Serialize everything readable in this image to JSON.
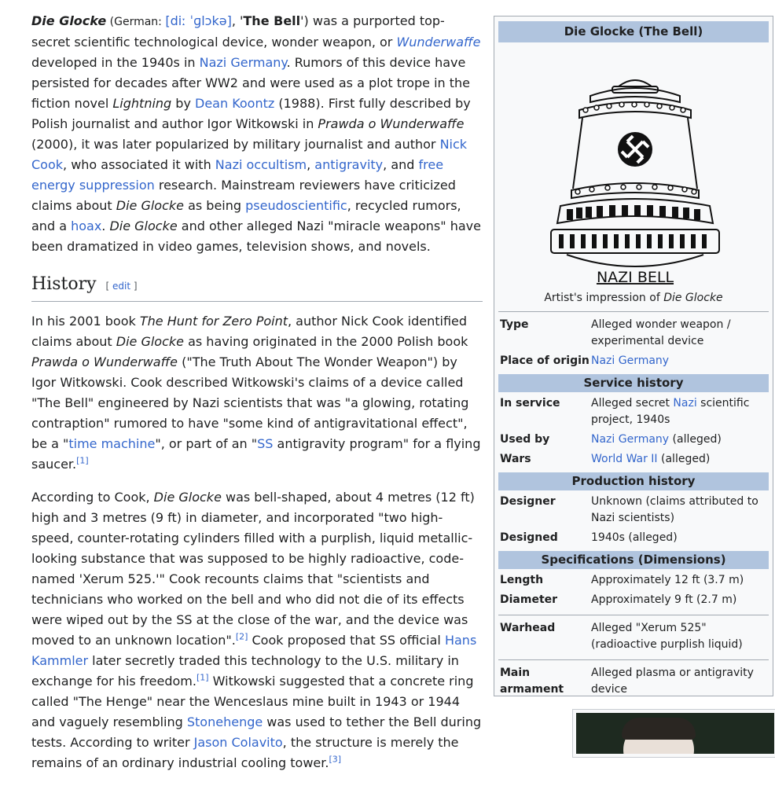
{
  "lead": {
    "title": "Die Glocke",
    "german_prefix": " (German: ",
    "ipa": "[diː ˈɡlɔkə]",
    "sep1": ", '",
    "bell": "The Bell",
    "t1": "') was a purported top-secret scientific technological device, wonder weapon, or ",
    "wunderwaffe": "Wunderwaffe",
    "t2": " developed in the 1940s in ",
    "nazi_germany": "Nazi Germany",
    "t3": ". Rumors of this device have persisted for decades after WW2 and were used as a plot trope in the fiction novel ",
    "lightning": "Lightning",
    "t4": " by ",
    "koontz": "Dean Koontz",
    "t5": " (1988). First fully described by Polish journalist and author Igor Witkowski in ",
    "prawda": "Prawda o Wunderwaffe",
    "t6": " (2000), it was later popularized by military journalist and author ",
    "nick_cook": "Nick Cook",
    "t7": ", who associated it with ",
    "occultism": "Nazi occultism",
    "c1": ", ",
    "antigravity": "antigravity",
    "t8": ", and ",
    "free_energy": "free energy suppression",
    "t9": " research. Mainstream reviewers have criticized claims about ",
    "die_glocke2": "Die Glocke",
    "t10": " as being ",
    "pseudo": "pseudoscientific",
    "t11": ", recycled rumors, and a ",
    "hoax": "hoax",
    "t12": ". ",
    "die_glocke3": "Die Glocke",
    "t13": " and other alleged Nazi \"miracle weapons\" have been dramatized in video games, television shows, and novels."
  },
  "history": {
    "heading": "History",
    "edit_open": "[ ",
    "edit": "edit",
    "edit_close": " ]",
    "p1": {
      "t1": "In his 2001 book ",
      "hunt": "The Hunt for Zero Point",
      "t2": ", author Nick Cook identified claims about ",
      "dg": "Die Glocke",
      "t3": " as having originated in the 2000 Polish book ",
      "prawda": "Prawda o Wunderwaffe",
      "t4": " (\"The Truth About The Wonder Weapon\") by Igor Witkowski. Cook described Witkowski's claims of a device called \"The Bell\" engineered by Nazi scientists that was \"a glowing, rotating contraption\" rumored to have \"some kind of antigravitational effect\", be a \"",
      "time_machine": "time machine",
      "t5": "\", or part of an \"",
      "ss": "SS",
      "t6": " antigravity program\" for a flying saucer.",
      "ref": "[1]"
    },
    "p2": {
      "t1": "According to Cook, ",
      "dg": "Die Glocke",
      "t2": " was bell-shaped, about 4 metres (12 ft) high and 3 metres (9 ft) in diameter, and incorporated \"two high-speed, counter-rotating cylinders filled with a purplish, liquid metallic-looking substance that was supposed to be highly radioactive, code-named 'Xerum 525.'\" Cook recounts claims that \"scientists and technicians who worked on the bell and who did not die of its effects were wiped out by the SS at the close of the war, and the device was moved to an unknown location\".",
      "ref2": "[2]",
      "t3": " Cook proposed that SS official ",
      "kammler": "Hans Kammler",
      "t4": " later secretly traded this technology to the U.S. military in exchange for his freedom.",
      "ref1": "[1]",
      "t5": " Witkowski suggested that a concrete ring called \"The Henge\" near the Wenceslaus mine built in 1943 or 1944 and vaguely resembling ",
      "stonehenge": "Stonehenge",
      "t6": " was used to tether the Bell during tests. According to writer ",
      "colavito": "Jason Colavito",
      "t7": ", the structure is merely the remains of an ordinary industrial cooling tower.",
      "ref3": "[3]"
    }
  },
  "infobox": {
    "title": "Die Glocke (The Bell)",
    "image_label": "NAZI BELL",
    "caption_prefix": "Artist's impression of ",
    "caption_italic": "Die Glocke",
    "type_label": "Type",
    "type_value": "Alleged wonder weapon / experimental device",
    "origin_label": "Place of origin",
    "origin_value": "Nazi Germany",
    "service_header": "Service history",
    "inservice_label": "In service",
    "inservice_pre": "Alleged secret ",
    "inservice_link": "Nazi",
    "inservice_post": " scientific project, 1940s",
    "usedby_label": "Used by",
    "usedby_link": "Nazi Germany",
    "usedby_post": " (alleged)",
    "wars_label": "Wars",
    "wars_link": "World War II",
    "wars_post": " (alleged)",
    "production_header": "Production history",
    "designer_label": "Designer",
    "designer_value": "Unknown (claims attributed to Nazi scientists)",
    "designed_label": "Designed",
    "designed_value": "1940s (alleged)",
    "specs_header": "Specifications (Dimensions)",
    "length_label": "Length",
    "length_value": "Approximately 12 ft (3.7 m)",
    "diameter_label": "Diameter",
    "diameter_value": "Approximately 9 ft (2.7 m)",
    "warhead_label": "Warhead",
    "warhead_value": "Alleged \"Xerum 525\" (radioactive purplish liquid)",
    "armament_label": "Main armament",
    "armament_value": "Alleged plasma or antigravity device"
  }
}
